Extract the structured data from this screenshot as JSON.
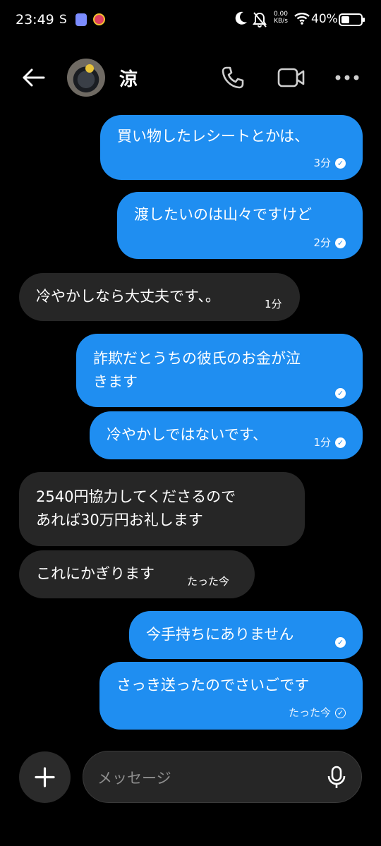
{
  "status_bar": {
    "time": "23:49",
    "carrier_letter": "S",
    "net_speed_value": "0.00",
    "net_speed_unit": "KB/s",
    "battery": "40%"
  },
  "header": {
    "contact_name": "涼",
    "icons": [
      "back-arrow-icon",
      "phone-icon",
      "video-camera-icon",
      "more-icon"
    ]
  },
  "messages": [
    {
      "side": "sent",
      "text": "買い物したレシートとかは、",
      "time": "3分",
      "read": true
    },
    {
      "side": "sent",
      "text": "渡したいのは山々ですけど",
      "time": "2分",
      "read": true
    },
    {
      "side": "received",
      "text": "冷やかしなら大丈夫です、。",
      "time": "1分"
    },
    {
      "side": "sent",
      "text": "詐欺だとうちの彼氏のお金が泣きます",
      "line1": "詐欺だとうちの彼氏のお金が泣",
      "line2": "きます",
      "time": "",
      "read": true
    },
    {
      "side": "sent",
      "text": "冷やかしではないです、",
      "time": "1分",
      "read": true
    },
    {
      "side": "received",
      "text": "2540円協力してくださるのであれば30万円お礼します",
      "line1": "2540円協力してくださるので",
      "line2": "あれば30万円お礼します",
      "time": ""
    },
    {
      "side": "received",
      "text": "これにかぎります",
      "time": "たった今"
    },
    {
      "side": "sent",
      "text": "今手持ちにありません",
      "time": "",
      "read": true
    },
    {
      "side": "sent",
      "text": "さっき送ったのでさいごです",
      "time": "たった今",
      "read": false
    }
  ],
  "composer": {
    "placeholder": "メッセージ"
  },
  "colors": {
    "background": "#000000",
    "sent_bubble": "#1f8ef1",
    "received_bubble": "#262626"
  }
}
